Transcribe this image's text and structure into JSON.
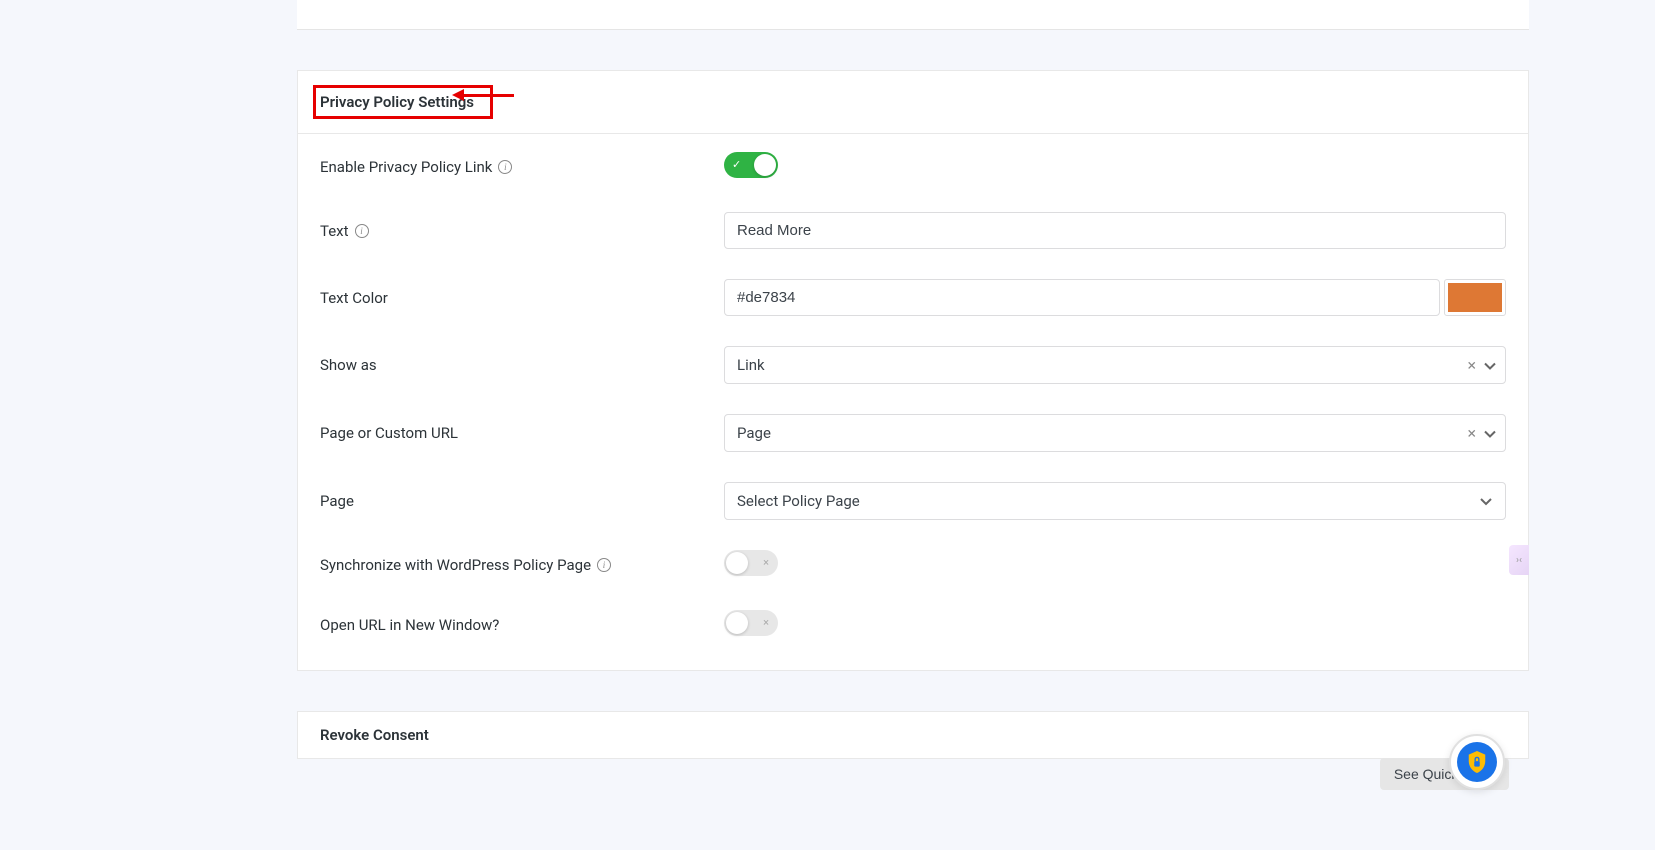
{
  "sections": {
    "privacy_policy": {
      "title": "Privacy Policy Settings",
      "fields": {
        "enable_link": {
          "label": "Enable Privacy Policy Link",
          "enabled": true
        },
        "text": {
          "label": "Text",
          "value": "Read More"
        },
        "text_color": {
          "label": "Text Color",
          "value": "#de7834"
        },
        "show_as": {
          "label": "Show as",
          "value": "Link"
        },
        "page_or_url": {
          "label": "Page or Custom URL",
          "value": "Page"
        },
        "page": {
          "label": "Page",
          "value": "Select Policy Page"
        },
        "sync_wp": {
          "label": "Synchronize with WordPress Policy Page",
          "enabled": false
        },
        "open_new_window": {
          "label": "Open URL in New Window?",
          "enabled": false
        }
      }
    },
    "revoke_consent": {
      "title": "Revoke Consent"
    }
  },
  "quick_links_label": "See Quick Links"
}
